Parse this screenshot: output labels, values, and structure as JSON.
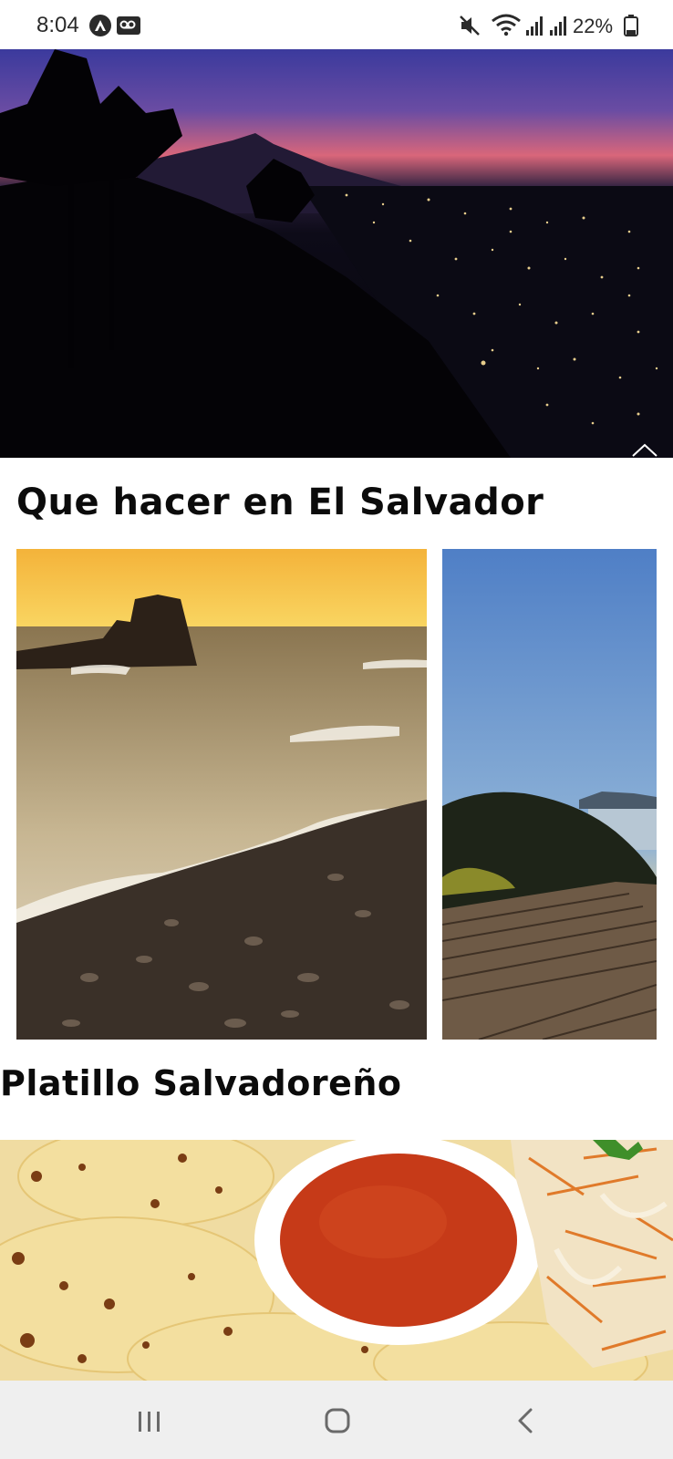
{
  "status_bar": {
    "time": "8:04",
    "battery": "22%"
  },
  "sections": {
    "things_to_do": "Que hacer en El Salvador",
    "dish": "Platillo Salvadoreño"
  },
  "images": {
    "hero": "night city view with volcano",
    "beach": "sunset beach with rock formation",
    "mountain": "mountain viewpoint with wooden deck",
    "food": "pupusas with salsa and curtido"
  },
  "icons": {
    "nav_recent": "recent-apps-icon",
    "nav_home": "home-icon",
    "nav_back": "back-icon"
  }
}
